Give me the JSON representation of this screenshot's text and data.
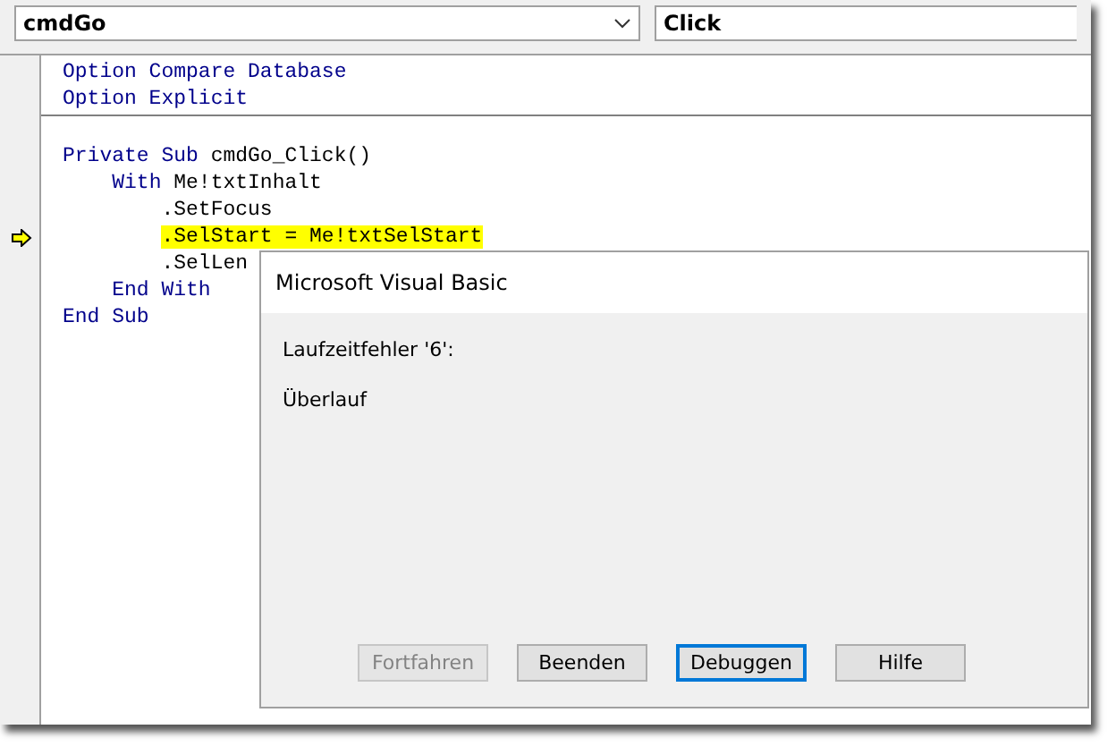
{
  "object_combo": {
    "value": "cmdGo"
  },
  "procedure_combo": {
    "value": "Click"
  },
  "code_sections": [
    {
      "lines": [
        {
          "current": false,
          "highlighted": false,
          "tokens": [
            {
              "kind": "keyword",
              "text": "Option Compare Database"
            }
          ]
        },
        {
          "current": false,
          "highlighted": false,
          "tokens": [
            {
              "kind": "keyword",
              "text": "Option Explicit"
            }
          ]
        }
      ]
    },
    {
      "lines": [
        {
          "current": false,
          "highlighted": false,
          "tokens": [
            {
              "kind": "keyword",
              "text": "Private Sub"
            },
            {
              "kind": "plain",
              "text": " cmdGo_Click()"
            }
          ]
        },
        {
          "current": false,
          "highlighted": false,
          "tokens": [
            {
              "kind": "keyword",
              "text": "    With"
            },
            {
              "kind": "plain",
              "text": " Me!txtInhalt"
            }
          ]
        },
        {
          "current": false,
          "highlighted": false,
          "tokens": [
            {
              "kind": "plain",
              "text": "        .SetFocus"
            }
          ]
        },
        {
          "current": true,
          "highlighted": true,
          "tokens": [
            {
              "kind": "plain",
              "text": "        .SelStart = Me!txtSelStart"
            }
          ]
        },
        {
          "current": false,
          "highlighted": false,
          "tokens": [
            {
              "kind": "plain",
              "text": "        .SelLen"
            }
          ]
        },
        {
          "current": false,
          "highlighted": false,
          "tokens": [
            {
              "kind": "keyword",
              "text": "    End With"
            }
          ]
        },
        {
          "current": false,
          "highlighted": false,
          "tokens": [
            {
              "kind": "keyword",
              "text": "End Sub"
            }
          ]
        }
      ]
    }
  ],
  "dialog": {
    "title": "Microsoft Visual Basic",
    "error_code": "Laufzeitfehler '6':",
    "message": "Überlauf",
    "buttons": [
      {
        "label": "Fortfahren",
        "disabled": true,
        "default": false
      },
      {
        "label": "Beenden",
        "disabled": false,
        "default": false
      },
      {
        "label": "Debuggen",
        "disabled": false,
        "default": true
      },
      {
        "label": "Hilfe",
        "disabled": false,
        "default": false
      }
    ]
  }
}
